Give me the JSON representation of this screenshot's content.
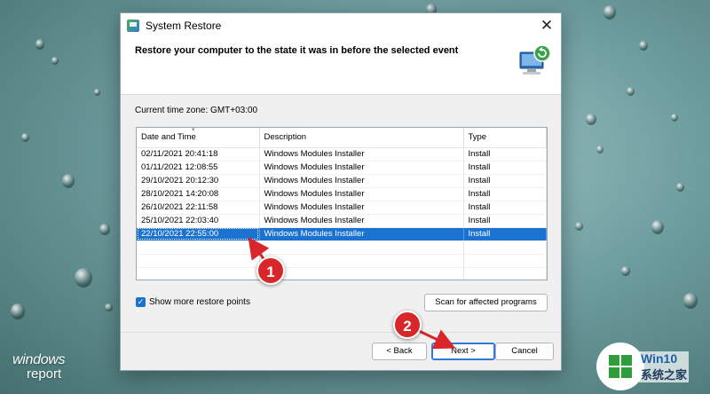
{
  "window": {
    "title": "System Restore",
    "close_label": "✕",
    "header_title": "Restore your computer to the state it was in before the selected event"
  },
  "timezone_text": "Current time zone: GMT+03:00",
  "table": {
    "columns": [
      "Date and Time",
      "Description",
      "Type"
    ],
    "rows": [
      {
        "date": "02/11/2021 20:41:18",
        "description": "Windows Modules Installer",
        "type": "Install"
      },
      {
        "date": "01/11/2021 12:08:55",
        "description": "Windows Modules Installer",
        "type": "Install"
      },
      {
        "date": "29/10/2021 20:12:30",
        "description": "Windows Modules Installer",
        "type": "Install"
      },
      {
        "date": "28/10/2021 14:20:08",
        "description": "Windows Modules Installer",
        "type": "Install"
      },
      {
        "date": "26/10/2021 22:11:58",
        "description": "Windows Modules Installer",
        "type": "Install"
      },
      {
        "date": "25/10/2021 22:03:40",
        "description": "Windows Modules Installer",
        "type": "Install"
      },
      {
        "date": "22/10/2021 22:55:00",
        "description": "Windows Modules Installer",
        "type": "Install"
      }
    ],
    "selected_row": "22/10/2021 22:55:00"
  },
  "checkbox": {
    "label": "Show more restore points",
    "checked": true
  },
  "buttons": {
    "scan": "Scan for affected programs",
    "back": "< Back",
    "next": "Next >",
    "cancel": "Cancel"
  },
  "callouts": {
    "one": "1",
    "two": "2"
  },
  "watermarks": {
    "left_line1": "windows",
    "left_line2": "report",
    "right_line1": "Win10",
    "right_line2": "系统之家"
  },
  "colors": {
    "selection": "#1c72d1",
    "callout": "#d8262a",
    "primary_border": "#2d7bd6"
  }
}
